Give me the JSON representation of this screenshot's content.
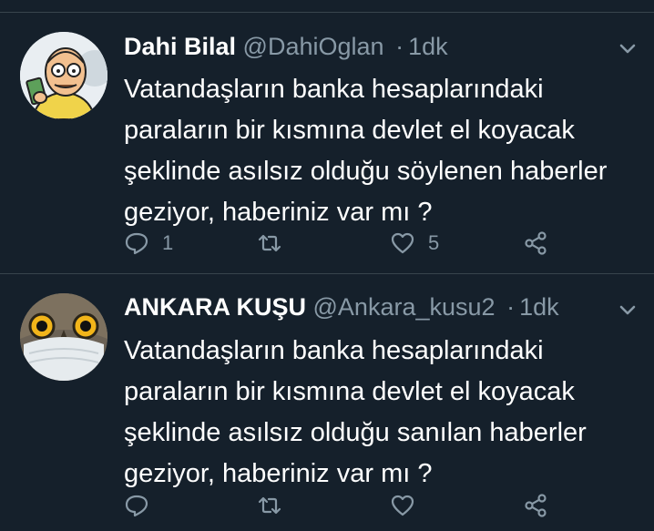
{
  "colors": {
    "background": "#15202b",
    "divider": "#38444d",
    "secondary_text": "#8899a6",
    "primary_text": "#ffffff"
  },
  "tweets": [
    {
      "display_name": "Dahi Bilal",
      "handle": "@DahiOglan",
      "separator": "·",
      "time": "1dk",
      "lines": [
        "Vatandaşların banka hesaplarındaki",
        "paraların bir kısmına devlet el koyacak",
        "şeklinde asılsız olduğu söylenen haberler",
        "geziyor, haberiniz var mı ?"
      ],
      "reply_count": "1",
      "retweet_count": "",
      "like_count": "5",
      "avatar_icon": "cartoon-man-holding-money"
    },
    {
      "display_name": "ANKARA KUŞU",
      "handle": "@Ankara_kusu2",
      "separator": "·",
      "time": "1dk",
      "lines": [
        "Vatandaşların banka hesaplarındaki",
        "paraların bir kısmına devlet el koyacak",
        "şeklinde asılsız olduğu sanılan haberler",
        "geziyor, haberiniz var mı ?"
      ],
      "reply_count": "",
      "retweet_count": "",
      "like_count": "",
      "avatar_icon": "owl-with-face-mask"
    }
  ],
  "icons": [
    "chevron-down-icon",
    "reply-icon",
    "retweet-icon",
    "like-icon",
    "share-icon"
  ]
}
